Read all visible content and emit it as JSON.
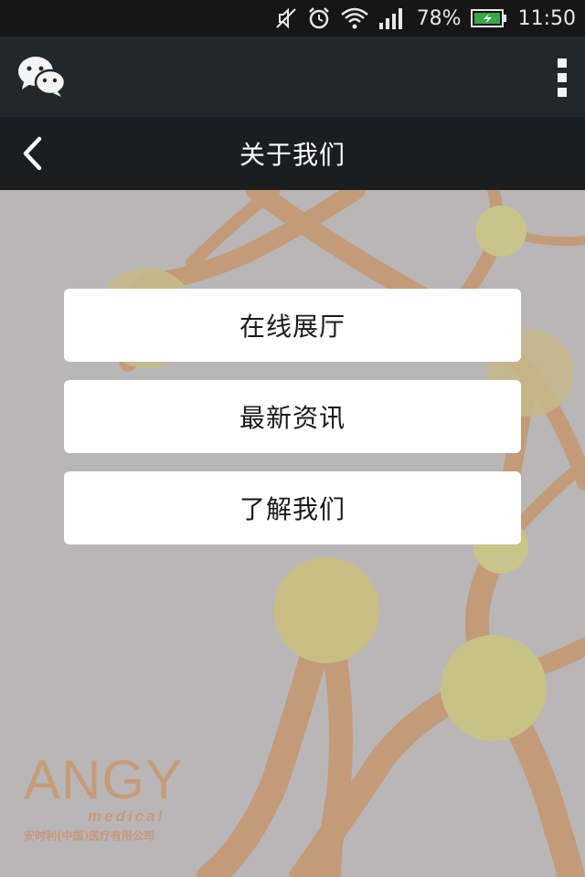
{
  "status_bar": {
    "battery_percent": "78%",
    "time": "11:50",
    "icons": [
      "muted-icon",
      "alarm-icon",
      "wifi-icon",
      "signal-icon",
      "battery-charging-icon"
    ]
  },
  "app_header": {
    "logo_icon": "wechat-icon",
    "menu_icon": "more-vert-icon"
  },
  "title_bar": {
    "back_icon": "chevron-left-icon",
    "title": "关于我们"
  },
  "menu": {
    "items": [
      {
        "label": "在线展厅"
      },
      {
        "label": "最新资讯"
      },
      {
        "label": "了解我们"
      }
    ]
  },
  "brand": {
    "name": "ANGY",
    "sub": "medical",
    "company": "安时利(中国)医疗有限公司"
  },
  "colors": {
    "status_bar_bg": "#161616",
    "app_header_bg": "#21282d",
    "title_bar_bg": "#1b1d1f",
    "page_bg": "#b9b6b8",
    "button_bg": "#ffffff",
    "brand_color": "#c79b78"
  }
}
